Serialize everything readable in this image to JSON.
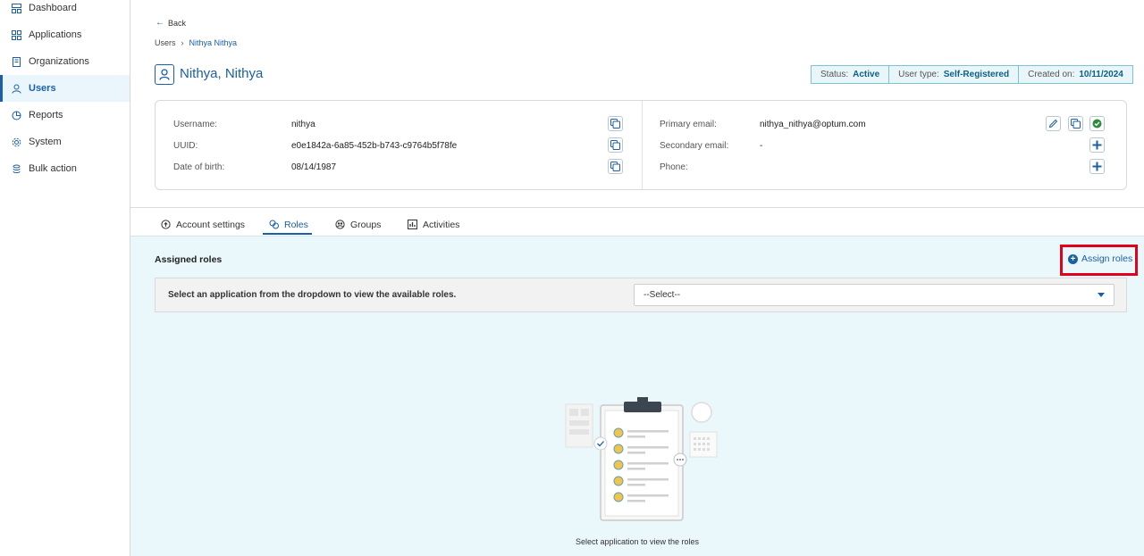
{
  "sidebar": {
    "items": [
      {
        "label": "Dashboard",
        "icon": "dashboard-icon"
      },
      {
        "label": "Applications",
        "icon": "applications-icon"
      },
      {
        "label": "Organizations",
        "icon": "building-icon"
      },
      {
        "label": "Users",
        "icon": "user-icon",
        "active": true
      },
      {
        "label": "Reports",
        "icon": "reports-icon"
      },
      {
        "label": "System",
        "icon": "gear-icon"
      },
      {
        "label": "Bulk action",
        "icon": "stack-icon"
      }
    ]
  },
  "header": {
    "back_label": "Back",
    "breadcrumb": {
      "root": "Users",
      "current": "Nithya Nithya"
    },
    "title": "Nithya, Nithya"
  },
  "status": {
    "status_label": "Status:",
    "status_value": "Active",
    "type_label": "User type:",
    "type_value": "Self-Registered",
    "created_label": "Created on:",
    "created_value": "10/11/2024"
  },
  "details": {
    "username_label": "Username:",
    "username_value": "nithya",
    "uuid_label": "UUID:",
    "uuid_value": "e0e1842a-6a85-452b-b743-c9764b5f78fe",
    "dob_label": "Date of birth:",
    "dob_value": "08/14/1987",
    "primary_email_label": "Primary email:",
    "primary_email_value": "nithya_nithya@optum.com",
    "secondary_email_label": "Secondary email:",
    "secondary_email_value": "-",
    "phone_label": "Phone:",
    "phone_value": ""
  },
  "tabs": [
    {
      "label": "Account settings",
      "icon": "info-circle-icon"
    },
    {
      "label": "Roles",
      "icon": "roles-icon",
      "active": true
    },
    {
      "label": "Groups",
      "icon": "groups-icon"
    },
    {
      "label": "Activities",
      "icon": "activities-icon"
    }
  ],
  "roles": {
    "heading": "Assigned roles",
    "assign_label": "Assign roles",
    "select_message": "Select an application from the dropdown to view the available roles.",
    "select_value": "--Select--",
    "empty_message": "Select application to view the roles"
  },
  "colors": {
    "accent": "#1a5fa8",
    "highlight": "#e2001a",
    "panel_bg": "#eaf7fb"
  }
}
